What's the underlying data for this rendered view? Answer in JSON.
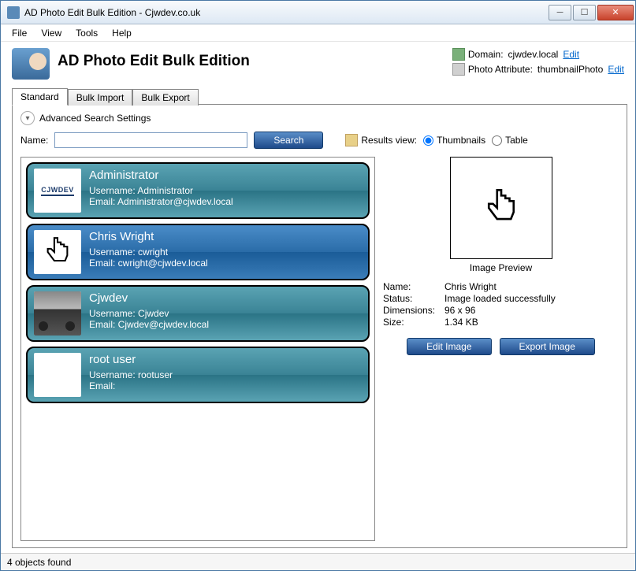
{
  "window": {
    "title": "AD Photo Edit Bulk Edition - Cjwdev.co.uk"
  },
  "menu": {
    "file": "File",
    "view": "View",
    "tools": "Tools",
    "help": "Help"
  },
  "header": {
    "app_title": "AD Photo Edit Bulk Edition",
    "domain_label": "Domain:",
    "domain_value": "cjwdev.local",
    "edit1": "Edit",
    "photo_attr_label": "Photo Attribute:",
    "photo_attr_value": "thumbnailPhoto",
    "edit2": "Edit"
  },
  "tabs": {
    "standard": "Standard",
    "bulk_import": "Bulk Import",
    "bulk_export": "Bulk Export"
  },
  "adv_search": "Advanced Search Settings",
  "search": {
    "name_label": "Name:",
    "name_value": "",
    "button": "Search",
    "results_view_label": "Results view:",
    "opt_thumb": "Thumbnails",
    "opt_table": "Table"
  },
  "results": [
    {
      "display_name": "Administrator",
      "username_label": "Username: Administrator",
      "email_label": "Email: Administrator@cjwdev.local",
      "thumb_type": "cjwdev",
      "selected": false
    },
    {
      "display_name": "Chris Wright",
      "username_label": "Username: cwright",
      "email_label": "Email: cwright@cjwdev.local",
      "thumb_type": "hand",
      "selected": true
    },
    {
      "display_name": "Cjwdev",
      "username_label": "Username: Cjwdev",
      "email_label": "Email: Cjwdev@cjwdev.local",
      "thumb_type": "car",
      "selected": false
    },
    {
      "display_name": "root user",
      "username_label": "Username: rootuser",
      "email_label": "Email:",
      "thumb_type": "blank",
      "selected": false
    }
  ],
  "preview": {
    "caption": "Image Preview",
    "name_label": "Name:",
    "name_value": "Chris Wright",
    "status_label": "Status:",
    "status_value": "Image loaded successfully",
    "dim_label": "Dimensions:",
    "dim_value": "96 x 96",
    "size_label": "Size:",
    "size_value": "1.34 KB",
    "edit_btn": "Edit Image",
    "export_btn": "Export Image"
  },
  "status": "4 objects found"
}
